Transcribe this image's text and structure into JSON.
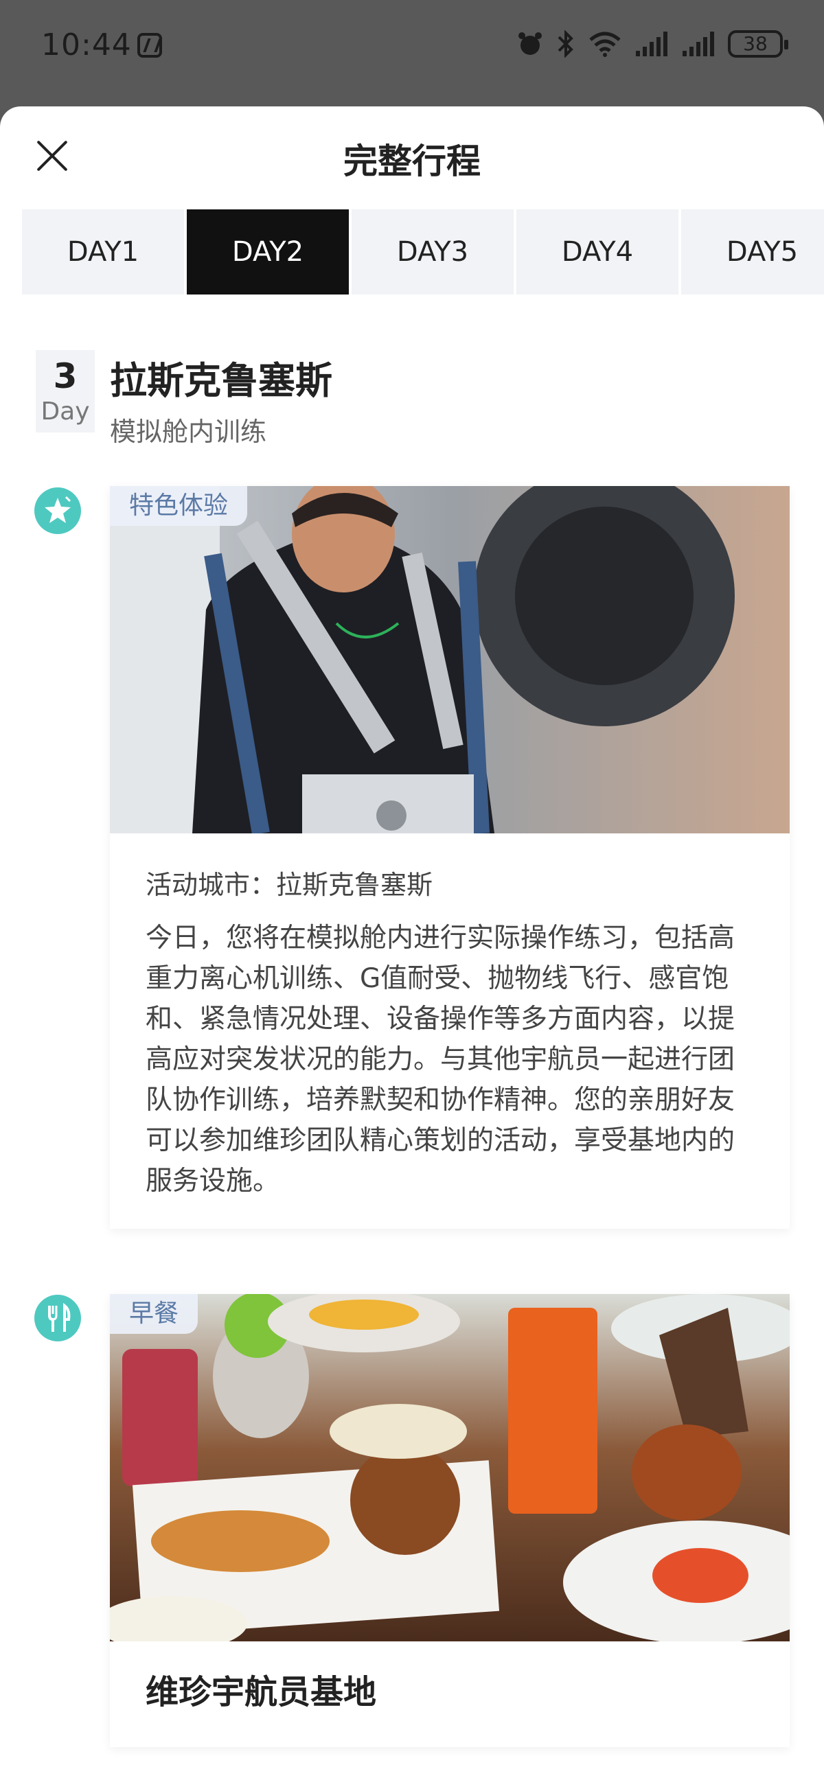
{
  "status_bar": {
    "time": "10:44",
    "battery": "38"
  },
  "sheet": {
    "title": "完整行程",
    "tabs": [
      "DAY1",
      "DAY2",
      "DAY3",
      "DAY4",
      "DAY5"
    ],
    "active_tab": "DAY2"
  },
  "day": {
    "number": "3",
    "label": "Day",
    "city": "拉斯克鲁塞斯",
    "subtitle": "模拟舱内训练"
  },
  "items": [
    {
      "icon": "star-icon",
      "tag": "特色体验",
      "city_line": "活动城市：拉斯克鲁塞斯",
      "description": "今日，您将在模拟舱内进行实际操作练习，包括高重力离心机训练、G值耐受、抛物线飞行、感官饱和、紧急情况处理、设备操作等多方面内容，以提高应对突发状况的能力。与其他宇航员一起进行团队协作训练，培养默契和协作精神。您的亲朋好友可以参加维珍团队精心策划的活动，享受基地内的服务设施。"
    },
    {
      "icon": "fork-knife-icon",
      "tag": "早餐",
      "name": "维珍宇航员基地"
    }
  ],
  "colors": {
    "accent": "#4ec9c0",
    "active_tab": "#111111",
    "tag_text": "#5b7aa6"
  }
}
